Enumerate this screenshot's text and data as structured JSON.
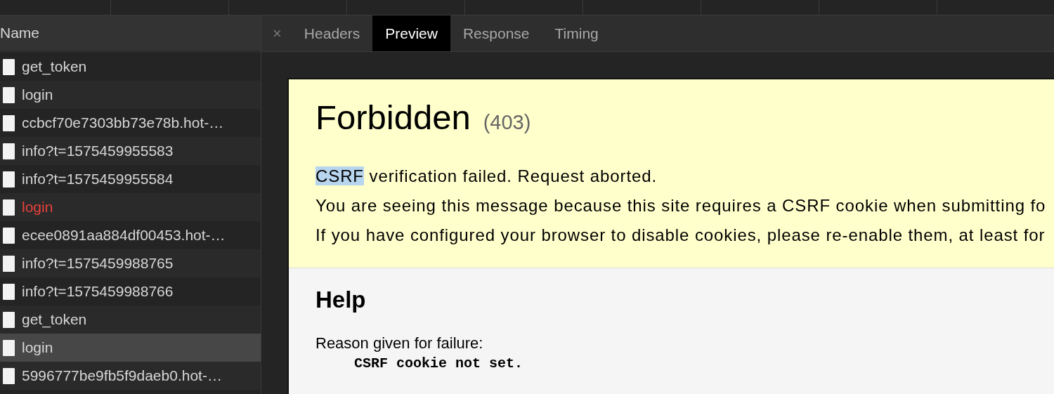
{
  "name_column": {
    "header": "Name"
  },
  "requests": [
    {
      "name": "get_token",
      "error": false,
      "selected": false
    },
    {
      "name": "login",
      "error": false,
      "selected": false
    },
    {
      "name": "ccbcf70e7303bb73e78b.hot-…",
      "error": false,
      "selected": false
    },
    {
      "name": "info?t=1575459955583",
      "error": false,
      "selected": false
    },
    {
      "name": "info?t=1575459955584",
      "error": false,
      "selected": false
    },
    {
      "name": "login",
      "error": true,
      "selected": false
    },
    {
      "name": "ecee0891aa884df00453.hot-…",
      "error": false,
      "selected": false
    },
    {
      "name": "info?t=1575459988765",
      "error": false,
      "selected": false
    },
    {
      "name": "info?t=1575459988766",
      "error": false,
      "selected": false
    },
    {
      "name": "get_token",
      "error": false,
      "selected": false
    },
    {
      "name": "login",
      "error": false,
      "selected": true
    },
    {
      "name": "5996777be9fb5f9daeb0.hot-…",
      "error": false,
      "selected": false
    }
  ],
  "detail_tabs": {
    "close": "×",
    "tabs": [
      {
        "label": "Headers",
        "selected": false
      },
      {
        "label": "Preview",
        "selected": true
      },
      {
        "label": "Response",
        "selected": false
      },
      {
        "label": "Timing",
        "selected": false
      }
    ]
  },
  "preview": {
    "title": "Forbidden",
    "status": "(403)",
    "message": {
      "selected_part": "CSRF",
      "rest": " verification failed. Request aborted."
    },
    "paragraphs": [
      "You are seeing this message because this site requires a CSRF cookie when submitting fo",
      "If you have configured your browser to disable cookies, please re-enable them, at least for"
    ],
    "help_title": "Help",
    "reason_label": "Reason given for failure:",
    "reason": "CSRF cookie not set."
  }
}
